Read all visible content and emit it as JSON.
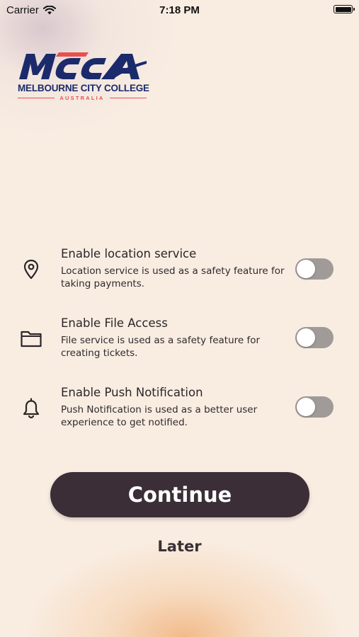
{
  "status_bar": {
    "carrier": "Carrier",
    "time": "7:18 PM",
    "icons": [
      "wifi-icon",
      "battery-icon"
    ]
  },
  "logo": {
    "mark_text": "MCCA",
    "name": "MELBOURNE CITY COLLEGE",
    "country": "AUSTRALIA",
    "colors": {
      "navy": "#1b2a6b",
      "red": "#e85050"
    }
  },
  "permissions": [
    {
      "icon": "location-pin-icon",
      "title": "Enable location service",
      "description": "Location service is used as a safety feature for taking payments.",
      "enabled": false
    },
    {
      "icon": "folder-icon",
      "title": "Enable File Access",
      "description": "File service is used as a safety feature for creating tickets.",
      "enabled": false
    },
    {
      "icon": "bell-icon",
      "title": "Enable Push Notification",
      "description": "Push Notification is used as a better user experience to get notified.",
      "enabled": false
    }
  ],
  "actions": {
    "continue_label": "Continue",
    "later_label": "Later"
  },
  "colors": {
    "background": "#f9ede2",
    "primary_button": "#3b2e36",
    "toggle_off": "#a09b98"
  }
}
